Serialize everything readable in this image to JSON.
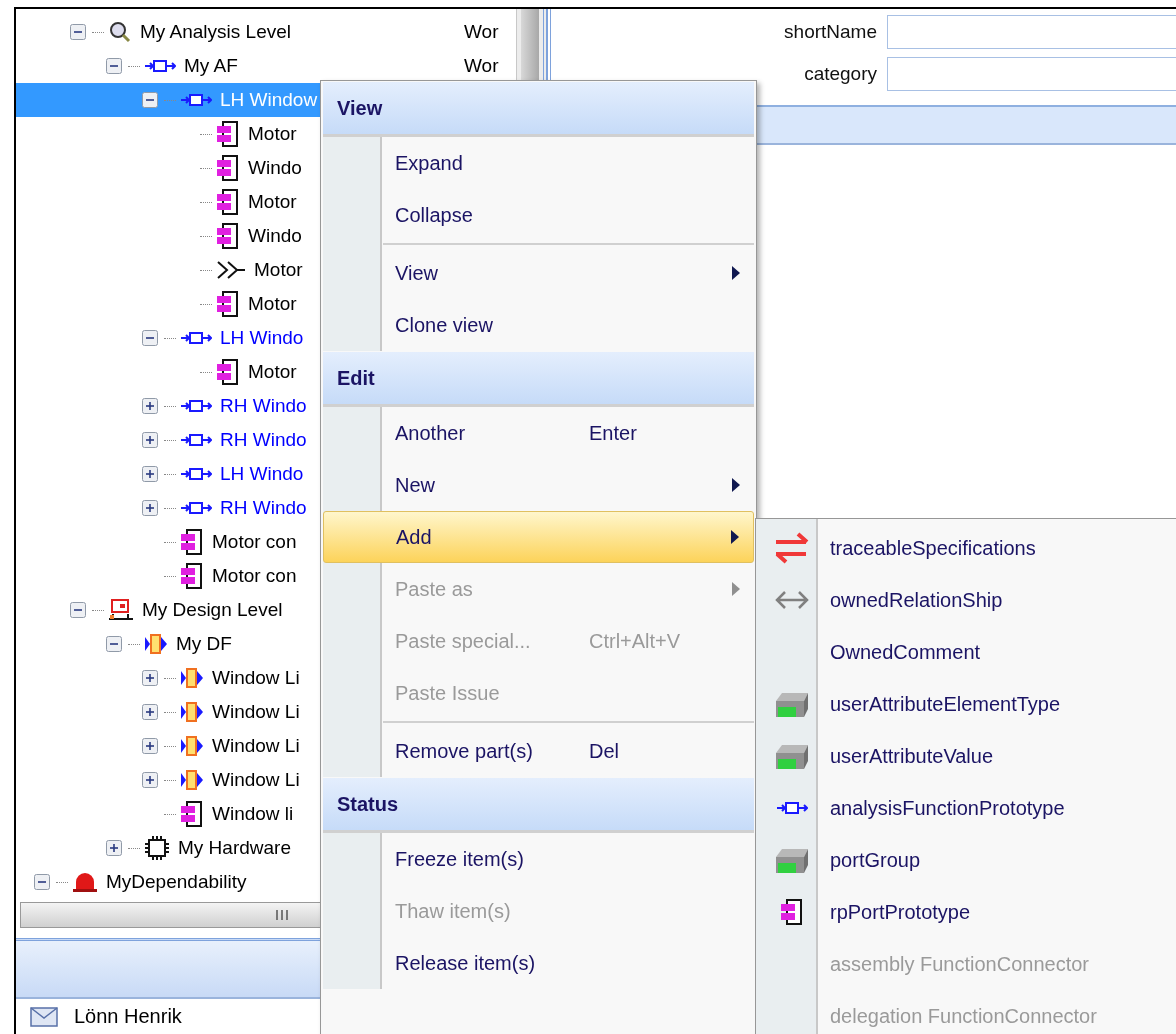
{
  "tree": {
    "items": [
      {
        "children": [
          {
            "label": "My Analysis Level",
            "kind": "analysis-level",
            "expanded": true,
            "selected": false,
            "color": "#000000",
            "column_2": "Wor",
            "children": [
              {
                "label": "My AF",
                "kind": "function",
                "expanded": true,
                "selected": false,
                "color": "#000000",
                "column_2": "Wor",
                "children": [
                  {
                    "label": "LH Window",
                    "kind": "function",
                    "expanded": true,
                    "selected": true,
                    "color": "#ffffff",
                    "children": [
                      {
                        "label": "Motor",
                        "kind": "port",
                        "selected": false,
                        "color": "#000000"
                      },
                      {
                        "label": "Windo",
                        "kind": "port",
                        "selected": false,
                        "color": "#000000"
                      },
                      {
                        "label": "Motor",
                        "kind": "port",
                        "selected": false,
                        "color": "#000000"
                      },
                      {
                        "label": "Windo",
                        "kind": "port",
                        "selected": false,
                        "color": "#000000"
                      },
                      {
                        "label": "Motor",
                        "kind": "flow",
                        "selected": false,
                        "color": "#000000"
                      },
                      {
                        "label": "Motor",
                        "kind": "port",
                        "selected": false,
                        "color": "#000000"
                      }
                    ]
                  },
                  {
                    "label": "LH Windo",
                    "kind": "function",
                    "expanded": true,
                    "selected": false,
                    "color": "#0000ff",
                    "children": [
                      {
                        "label": "Motor",
                        "kind": "port",
                        "selected": false,
                        "color": "#000000"
                      }
                    ]
                  },
                  {
                    "label": "RH Windo",
                    "kind": "function",
                    "expanded": false,
                    "selected": false,
                    "color": "#0000ff"
                  },
                  {
                    "label": "RH Windo",
                    "kind": "function",
                    "expanded": false,
                    "selected": false,
                    "color": "#0000ff"
                  },
                  {
                    "label": "LH Windo",
                    "kind": "function",
                    "expanded": false,
                    "selected": false,
                    "color": "#0000ff"
                  },
                  {
                    "label": "RH Windo",
                    "kind": "function",
                    "expanded": false,
                    "selected": false,
                    "color": "#0000ff"
                  },
                  {
                    "label": "Motor con",
                    "kind": "port",
                    "selected": false,
                    "color": "#000000"
                  },
                  {
                    "label": "Motor con",
                    "kind": "port",
                    "selected": false,
                    "color": "#000000"
                  }
                ]
              }
            ]
          },
          {
            "label": "My Design Level",
            "kind": "design-level",
            "expanded": true,
            "selected": false,
            "color": "#000000",
            "children": [
              {
                "label": "My DF",
                "kind": "design-function",
                "expanded": true,
                "selected": false,
                "color": "#000000",
                "children": [
                  {
                    "label": "Window Li",
                    "kind": "design-function",
                    "expanded": false,
                    "selected": false,
                    "color": "#000000"
                  },
                  {
                    "label": "Window Li",
                    "kind": "design-function",
                    "expanded": false,
                    "selected": false,
                    "color": "#000000"
                  },
                  {
                    "label": "Window Li",
                    "kind": "design-function",
                    "expanded": false,
                    "selected": false,
                    "color": "#000000"
                  },
                  {
                    "label": "Window Li",
                    "kind": "design-function",
                    "expanded": false,
                    "selected": false,
                    "color": "#000000"
                  },
                  {
                    "label": "Window li",
                    "kind": "port",
                    "selected": false,
                    "color": "#000000"
                  }
                ]
              },
              {
                "label": "My Hardware",
                "kind": "hardware",
                "expanded": false,
                "selected": false,
                "color": "#000000"
              }
            ]
          }
        ]
      },
      {
        "label": "MyDependability",
        "kind": "dependability",
        "expanded": true,
        "selected": false,
        "color": "#000000"
      }
    ]
  },
  "user": {
    "name": "Lönn Henrik"
  },
  "form": {
    "fields": [
      {
        "label": "shortName"
      },
      {
        "label": "category"
      }
    ]
  },
  "context_menu": {
    "sections": [
      {
        "title": "View",
        "items": [
          {
            "label": "Expand",
            "submenu": false,
            "disabled": false,
            "selected": false,
            "separator_before": false
          },
          {
            "label": "Collapse",
            "submenu": false,
            "disabled": false,
            "selected": false,
            "separator_before": false
          },
          {
            "label": "View",
            "submenu": true,
            "disabled": false,
            "selected": false,
            "separator_before": true
          },
          {
            "label": "Clone view",
            "submenu": false,
            "disabled": false,
            "selected": false,
            "separator_before": false
          }
        ]
      },
      {
        "title": "Edit",
        "items": [
          {
            "label": "Another",
            "shortcut": "Enter",
            "submenu": false,
            "disabled": false,
            "selected": false,
            "separator_before": false
          },
          {
            "label": "New",
            "submenu": true,
            "disabled": false,
            "selected": false,
            "separator_before": false
          },
          {
            "label": "Add",
            "submenu": true,
            "disabled": false,
            "selected": true,
            "separator_before": false
          },
          {
            "label": "Paste as",
            "submenu": true,
            "disabled": true,
            "selected": false,
            "separator_before": false
          },
          {
            "label": "Paste special...",
            "shortcut": "Ctrl+Alt+V",
            "submenu": false,
            "disabled": true,
            "selected": false,
            "separator_before": false
          },
          {
            "label": "Paste Issue",
            "submenu": false,
            "disabled": true,
            "selected": false,
            "separator_before": false
          },
          {
            "label": "Remove part(s)",
            "shortcut": "Del",
            "submenu": false,
            "disabled": false,
            "selected": false,
            "separator_before": true
          }
        ]
      },
      {
        "title": "Status",
        "items": [
          {
            "label": "Freeze item(s)",
            "submenu": false,
            "disabled": false,
            "selected": false,
            "separator_before": false
          },
          {
            "label": "Thaw item(s)",
            "submenu": false,
            "disabled": true,
            "selected": false,
            "separator_before": false
          },
          {
            "label": "Release item(s)",
            "submenu": false,
            "disabled": false,
            "selected": false,
            "separator_before": false
          }
        ]
      }
    ]
  },
  "submenu": {
    "items": [
      {
        "label": "traceableSpecifications",
        "kind": "trace",
        "disabled": false
      },
      {
        "label": "ownedRelationShip",
        "kind": "relation",
        "disabled": false
      },
      {
        "label": "OwnedComment",
        "kind": "none",
        "disabled": false
      },
      {
        "label": "userAttributeElementType",
        "kind": "attribute",
        "disabled": false
      },
      {
        "label": "userAttributeValue",
        "kind": "attribute",
        "disabled": false
      },
      {
        "label": "analysisFunctionPrototype",
        "kind": "function",
        "disabled": false
      },
      {
        "label": "portGroup",
        "kind": "attribute",
        "disabled": false
      },
      {
        "label": "rpPortPrototype",
        "kind": "port",
        "disabled": false
      },
      {
        "label": "assembly FunctionConnector",
        "kind": "none",
        "disabled": true
      },
      {
        "label": "delegation FunctionConnector",
        "kind": "none",
        "disabled": true
      }
    ]
  }
}
